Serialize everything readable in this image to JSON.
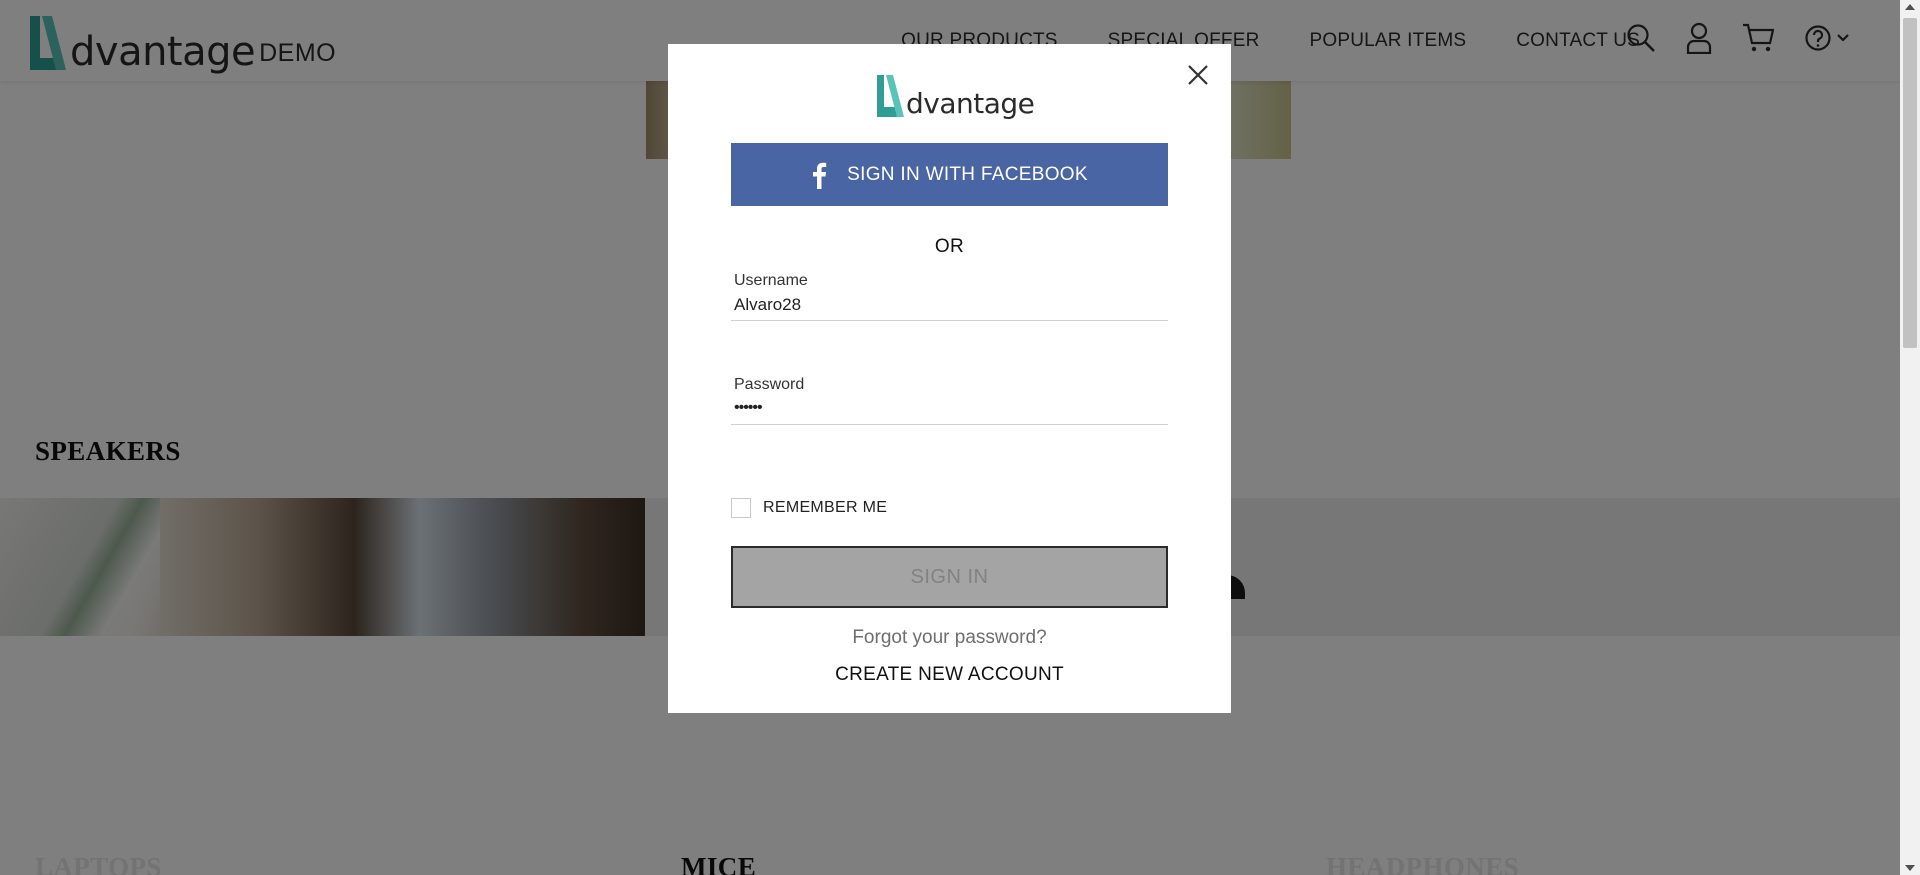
{
  "header": {
    "logo": {
      "brand": "dvantage",
      "demo": "DEMO"
    },
    "nav": [
      "OUR PRODUCTS",
      "SPECIAL OFFER",
      "POPULAR ITEMS",
      "CONTACT US"
    ],
    "icons": [
      "search-icon",
      "user-icon",
      "cart-icon",
      "help-icon",
      "chevron-down-icon"
    ]
  },
  "categories": {
    "speakers": "SPEAKERS",
    "laptops": "LAPTOPS",
    "mice": "MICE",
    "headphones": "HEADPHONES"
  },
  "modal": {
    "logo_text": "dvantage",
    "facebook_label": "SIGN IN WITH FACEBOOK",
    "or_label": "OR",
    "username_label": "Username",
    "username_value": "Alvaro28",
    "password_label": "Password",
    "password_value": "••••••",
    "remember_label": "REMEMBER ME",
    "signin_label": "SIGN IN",
    "forgot_label": "Forgot your password?",
    "create_label": "CREATE NEW ACCOUNT"
  },
  "colors": {
    "accent": "#2aa198",
    "facebook": "#4a65a3",
    "overlay": "rgba(0,0,0,0.5)"
  }
}
